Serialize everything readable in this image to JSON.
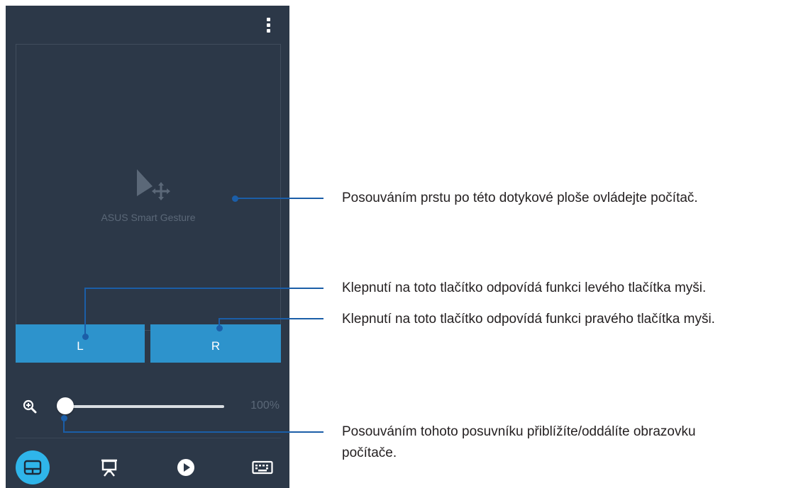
{
  "touchpad": {
    "label": "ASUS Smart Gesture"
  },
  "buttons": {
    "left_label": "L",
    "right_label": "R"
  },
  "zoom": {
    "value_text": "100%",
    "level_percent": 0
  },
  "bottom_nav": {
    "items": [
      "touchpad-icon",
      "presentation-icon",
      "play-icon",
      "keyboard-icon"
    ],
    "active": "touchpad-icon"
  },
  "colors": {
    "app_background": "#2c3848",
    "button_blue": "#2d93cc",
    "active_nav": "#2fb5ea",
    "callout_line": "#1b5ea8"
  },
  "callouts": {
    "touchpad": "Posouváním prstu po této dotykové ploše ovládejte počítač.",
    "left_button": "Klepnutí na toto tlačítko odpovídá funkci levého tlačítka myši.",
    "right_button": "Klepnutí na toto tlačítko odpovídá funkci pravého tlačítka myši.",
    "slider_line1": "Posouváním tohoto posuvníku přiblížíte/oddálíte obrazovku",
    "slider_line2": "počítače."
  }
}
